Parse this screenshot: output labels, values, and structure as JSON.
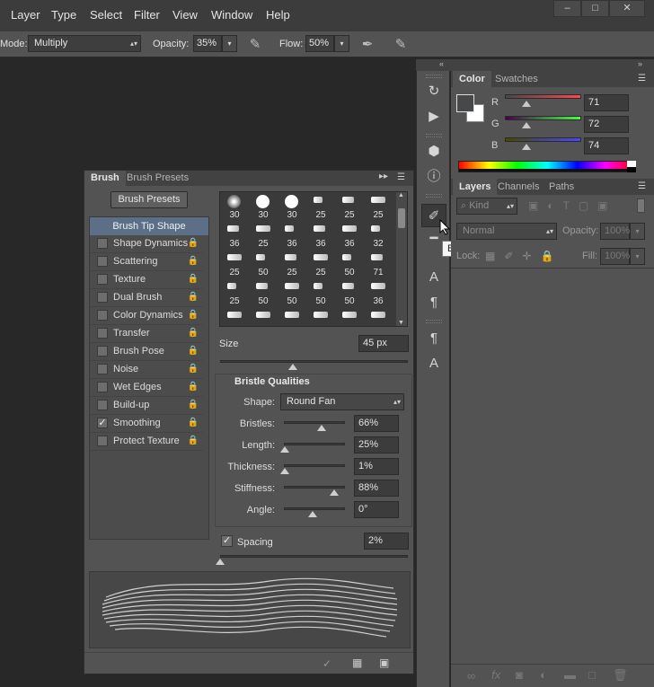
{
  "menu": [
    "Layer",
    "Type",
    "Select",
    "Filter",
    "View",
    "Window",
    "Help"
  ],
  "window_controls": [
    "minimize",
    "maximize",
    "close"
  ],
  "options": {
    "mode_label": "Mode:",
    "mode_value": "Multiply",
    "opacity_label": "Opacity:",
    "opacity_value": "35%",
    "flow_label": "Flow:",
    "flow_value": "50%"
  },
  "tooltip": "Brush",
  "color_panel": {
    "tabs": [
      "Color",
      "Swatches"
    ],
    "r_label": "R",
    "r_value": "71",
    "g_label": "G",
    "g_value": "72",
    "b_label": "B",
    "b_value": "74"
  },
  "layers_panel": {
    "tabs": [
      "Layers",
      "Channels",
      "Paths"
    ],
    "filter_kind": "Kind",
    "blend_mode": "Normal",
    "opacity_label": "Opacity:",
    "opacity_value": "100%",
    "lock_label": "Lock:",
    "fill_label": "Fill:",
    "fill_value": "100%"
  },
  "brush_panel": {
    "tabs": [
      "Brush",
      "Brush Presets"
    ],
    "presets_button": "Brush Presets",
    "tip_shape": "Brush Tip Shape",
    "options": [
      {
        "label": "Shape Dynamics",
        "checked": false
      },
      {
        "label": "Scattering",
        "checked": false
      },
      {
        "label": "Texture",
        "checked": false
      },
      {
        "label": "Dual Brush",
        "checked": false
      },
      {
        "label": "Color Dynamics",
        "checked": false
      },
      {
        "label": "Transfer",
        "checked": false
      },
      {
        "label": "Brush Pose",
        "checked": false
      },
      {
        "label": "Noise",
        "checked": false
      },
      {
        "label": "Wet Edges",
        "checked": false
      },
      {
        "label": "Build-up",
        "checked": false
      },
      {
        "label": "Smoothing",
        "checked": true
      },
      {
        "label": "Protect Texture",
        "checked": false
      }
    ],
    "tip_sizes": [
      [
        "30",
        "30",
        "30",
        "25",
        "25",
        "25"
      ],
      [
        "36",
        "25",
        "36",
        "36",
        "36",
        "32"
      ],
      [
        "25",
        "50",
        "25",
        "25",
        "50",
        "71"
      ],
      [
        "25",
        "50",
        "50",
        "50",
        "50",
        "36"
      ]
    ],
    "size_label": "Size",
    "size_value": "45 px",
    "bristle_header": "Bristle Qualities",
    "shape_label": "Shape:",
    "shape_value": "Round Fan",
    "bristle_rows": [
      {
        "label": "Bristles:",
        "value": "66%",
        "level": 0.66
      },
      {
        "label": "Length:",
        "value": "25%",
        "level": 0.0
      },
      {
        "label": "Thickness:",
        "value": "1%",
        "level": 0.0
      },
      {
        "label": "Stiffness:",
        "value": "88%",
        "level": 0.88
      },
      {
        "label": "Angle:",
        "value": "0°",
        "level": 0.5
      }
    ],
    "spacing_label": "Spacing",
    "spacing_value": "2%"
  }
}
